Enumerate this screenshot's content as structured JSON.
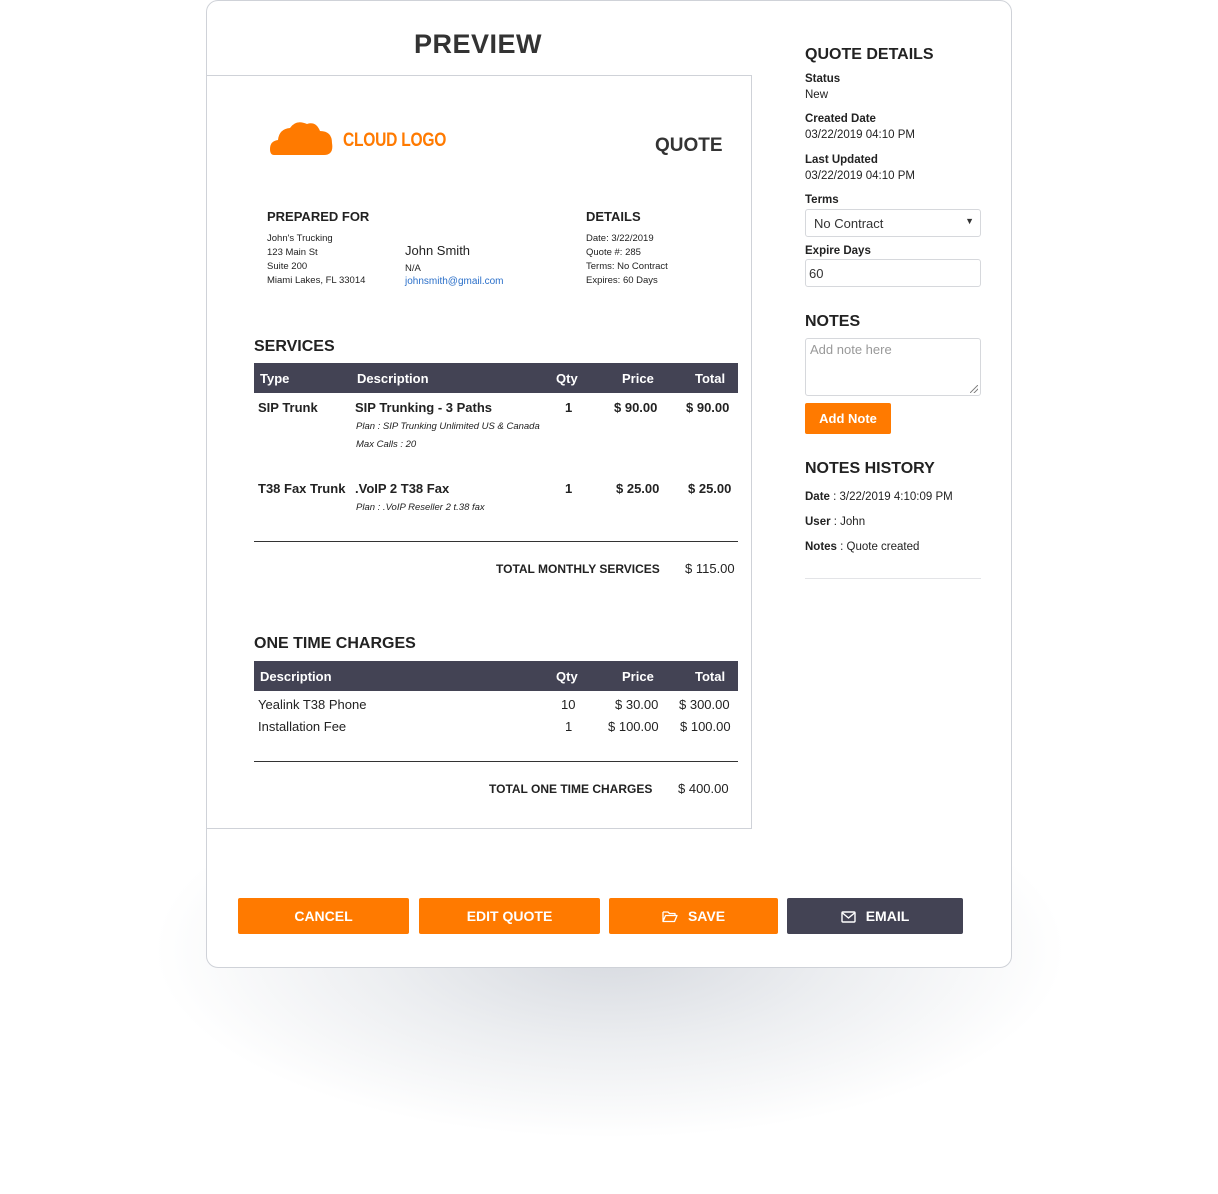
{
  "preview_title": "PREVIEW",
  "document": {
    "logo_text": "CLOUD LOGO",
    "doc_type": "QUOTE",
    "prepared_for": {
      "heading": "PREPARED FOR",
      "company": "John's Trucking",
      "address1": "123 Main St",
      "address2": "Suite 200",
      "city": "Miami Lakes, FL 33014",
      "contact_name": "John Smith",
      "contact_phone": "N/A",
      "contact_email": "johnsmith@gmail.com"
    },
    "details": {
      "heading": "DETAILS",
      "date": "Date: 3/22/2019",
      "quote_no": "Quote #: 285",
      "terms": "Terms: No Contract",
      "expires": "Expires: 60 Days"
    },
    "services": {
      "heading": "SERVICES",
      "columns": [
        "Type",
        "Description",
        "Qty",
        "Price",
        "Total"
      ],
      "rows": [
        {
          "type": "SIP Trunk",
          "description": "SIP Trunking - 3 Paths",
          "plan": "Plan : SIP Trunking Unlimited US & Canada",
          "extra": "Max Calls : 20",
          "qty": "1",
          "price": "$ 90.00",
          "total": "$ 90.00"
        },
        {
          "type": "T38 Fax Trunk",
          "description": ".VoIP 2 T38 Fax",
          "plan": "Plan : .VoIP Reseller 2 t.38 fax",
          "extra": "",
          "qty": "1",
          "price": "$ 25.00",
          "total": "$ 25.00"
        }
      ],
      "total_label": "TOTAL MONTHLY SERVICES",
      "total_value": "$ 115.00"
    },
    "one_time": {
      "heading": "ONE TIME CHARGES",
      "columns": [
        "Description",
        "Qty",
        "Price",
        "Total"
      ],
      "rows": [
        {
          "description": "Yealink T38 Phone",
          "qty": "10",
          "price": "$ 30.00",
          "total": "$ 300.00"
        },
        {
          "description": "Installation Fee",
          "qty": "1",
          "price": "$ 100.00",
          "total": "$ 100.00"
        }
      ],
      "total_label": "TOTAL ONE TIME CHARGES",
      "total_value": "$ 400.00"
    }
  },
  "quote_details": {
    "heading": "QUOTE DETAILS",
    "status_label": "Status",
    "status_value": "New",
    "created_label": "Created Date",
    "created_value": "03/22/2019 04:10 PM",
    "updated_label": "Last Updated",
    "updated_value": "03/22/2019 04:10 PM",
    "terms_label": "Terms",
    "terms_value": "No Contract",
    "expire_label": "Expire Days",
    "expire_value": "60"
  },
  "notes": {
    "heading": "NOTES",
    "placeholder": "Add note here",
    "add_button": "Add Note"
  },
  "notes_history": {
    "heading": "NOTES HISTORY",
    "date_label": "Date",
    "date_value": " : 3/22/2019 4:10:09 PM",
    "user_label": "User",
    "user_value": " : John",
    "notes_label": "Notes",
    "notes_value": " : Quote created"
  },
  "actions": {
    "cancel": "CANCEL",
    "edit": "EDIT QUOTE",
    "save": "SAVE",
    "email": "EMAIL"
  },
  "colors": {
    "accent": "#ff7a00",
    "table_header": "#434354",
    "link": "#2a6fc9"
  }
}
